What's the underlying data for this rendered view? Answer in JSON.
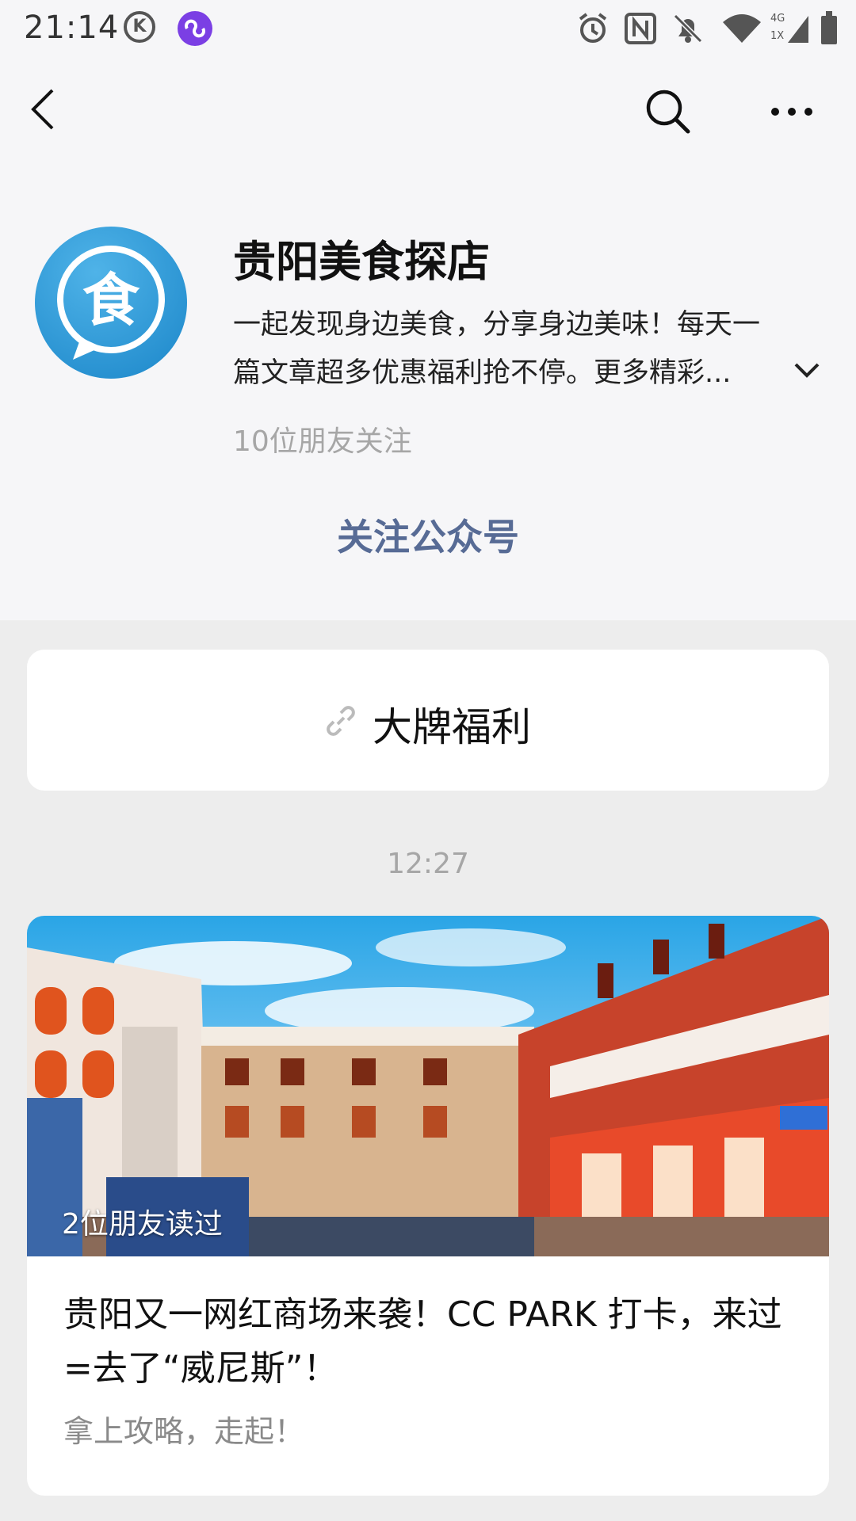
{
  "status_bar": {
    "time": "21:14",
    "icons": [
      "k-app-icon",
      "link-app-icon",
      "alarm-icon",
      "nfc-icon",
      "mute-icon",
      "wifi-icon",
      "signal-4g-icon",
      "battery-icon"
    ],
    "network_label": "4G",
    "sim_label": "1X"
  },
  "nav": {
    "back_icon": "back-chevron-icon",
    "search_icon": "search-icon",
    "more_icon": "more-icon"
  },
  "profile": {
    "avatar_char": "食",
    "name": "贵阳美食探店",
    "description_line1": "一起发现身边美食，分享身边美味！每天一",
    "description_line2": "篇文章超多优惠福利抢不停。更多精彩...",
    "followers": "10位朋友关注",
    "follow_button": "关注公众号"
  },
  "menu": {
    "item_label": "大牌福利",
    "item_icon": "link-icon"
  },
  "feed": {
    "timestamp": "12:27",
    "article": {
      "friends_read": "2位朋友读过",
      "title": "贵阳又一网红商场来袭！CC PARK 打卡，来过=去了“威尼斯”！",
      "subtitle": "拿上攻略，走起！"
    }
  },
  "colors": {
    "follow_link": "#576b95",
    "avatar_blue": "#2a95d6",
    "background": "#ededed",
    "header_bg": "#f6f6f8"
  }
}
